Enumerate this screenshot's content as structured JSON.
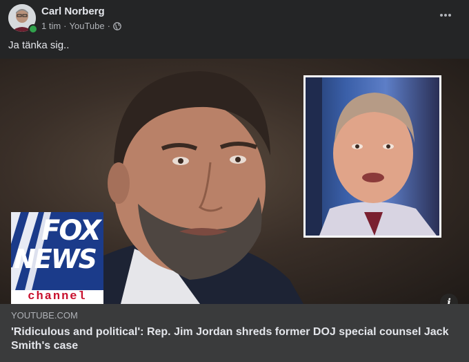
{
  "post": {
    "author": "Carl Norberg",
    "time": "1 tim",
    "separator": "·",
    "source": "YouTube",
    "separator2": "·",
    "audience_icon": "globe-icon",
    "more_icon": "more-horizontal-icon",
    "text": "Ja tänka sig.."
  },
  "media": {
    "logo_text_top": "FOX",
    "logo_text_middle": "NEWS",
    "logo_text_bottom": "channel",
    "info_label": "i"
  },
  "link": {
    "domain": "YOUTUBE.COM",
    "headline": "'Ridiculous and political': Rep. Jim Jordan shreds former DOJ special counsel Jack Smith's case"
  },
  "colors": {
    "background": "#242526",
    "preview_bg": "#3a3b3c",
    "online": "#31a24c",
    "fox_blue": "#1b3b8a",
    "fox_red": "#c8102e"
  }
}
